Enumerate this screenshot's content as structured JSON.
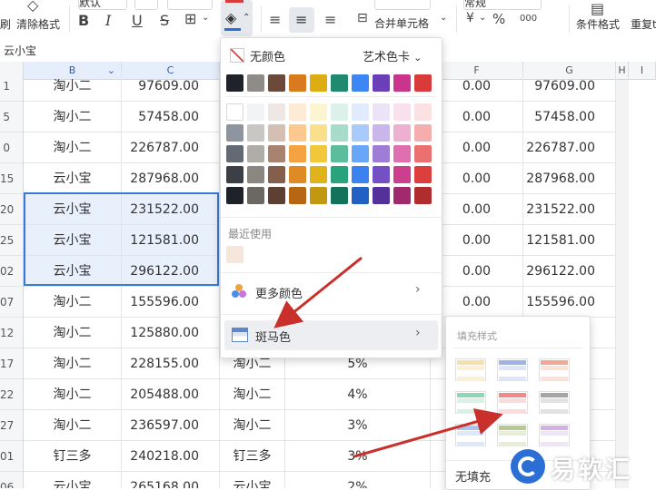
{
  "toolbar": {
    "font_name": "默认",
    "clear_label_partial": "刷",
    "clear_format": "清除格式",
    "merge_cells": "合并单元格",
    "number_format_partial": "常规",
    "conditional_format": "条件格式",
    "redo_partial": "重复t",
    "bold_icon": "B",
    "italic_icon": "I",
    "underline_icon": "U",
    "strike_icon": "S",
    "percent": "%",
    "thousands": "000"
  },
  "namebox": {
    "value": "云小宝"
  },
  "columns": [
    {
      "label": "B"
    },
    {
      "label": "C"
    },
    {
      "label": "F"
    },
    {
      "label": "G"
    },
    {
      "label": "H"
    },
    {
      "label": "I"
    }
  ],
  "rows": [
    {
      "num": "1",
      "b": "淘小二",
      "c": "97609.00",
      "d": "",
      "e": "",
      "f": "0.00",
      "g": "97609.00"
    },
    {
      "num": "5",
      "b": "淘小二",
      "c": "57458.00",
      "d": "",
      "e": "",
      "f": "0.00",
      "g": "57458.00"
    },
    {
      "num": "0",
      "b": "淘小二",
      "c": "226787.00",
      "d": "",
      "e": "",
      "f": "0.00",
      "g": "226787.00"
    },
    {
      "num": "15",
      "b": "云小宝",
      "c": "287968.00",
      "d": "",
      "e": "",
      "f": "0.00",
      "g": "287968.00"
    },
    {
      "num": "20",
      "b": "云小宝",
      "c": "231522.00",
      "d": "",
      "e": "",
      "f": "0.00",
      "g": "231522.00"
    },
    {
      "num": "25",
      "b": "云小宝",
      "c": "121581.00",
      "d": "",
      "e": "",
      "f": "0.00",
      "g": "121581.00"
    },
    {
      "num": "02",
      "b": "云小宝",
      "c": "296122.00",
      "d": "",
      "e": "",
      "f": "0.00",
      "g": "296122.00"
    },
    {
      "num": "07",
      "b": "淘小二",
      "c": "155596.00",
      "d": "",
      "e": "",
      "f": "0.00",
      "g": "155596.00"
    },
    {
      "num": "12",
      "b": "淘小二",
      "c": "125880.00",
      "d": "",
      "e": "",
      "f": "",
      "g": ""
    },
    {
      "num": "17",
      "b": "淘小二",
      "c": "228155.00",
      "d": "淘小二",
      "e": "5%",
      "f": "",
      "g": ""
    },
    {
      "num": "22",
      "b": "淘小二",
      "c": "205488.00",
      "d": "淘小二",
      "e": "4%",
      "f": "",
      "g": ""
    },
    {
      "num": "27",
      "b": "淘小二",
      "c": "236597.00",
      "d": "淘小二",
      "e": "3%",
      "f": "",
      "g": ""
    },
    {
      "num": "01",
      "b": "钉三多",
      "c": "240218.00",
      "d": "钉三多",
      "e": "3%",
      "f": "",
      "g": ""
    },
    {
      "num": "06",
      "b": "云小宝",
      "c": "265168.00",
      "d": "云小宝",
      "e": "2%",
      "f": "",
      "g": ""
    }
  ],
  "color_panel": {
    "no_color": "无颜色",
    "palette_name": "艺术色卡",
    "recent_label": "最近使用",
    "more_colors": "更多颜色",
    "zebra": "斑马色",
    "theme_row": [
      "#1f2329",
      "#8f8b87",
      "#6b4a3a",
      "#d97a1f",
      "#dcae14",
      "#1f8a6e",
      "#3d87f5",
      "#6a3fb8",
      "#c8358a",
      "#d93a3a"
    ],
    "shade_rows": [
      [
        "#ffffff",
        "#f2f3f5",
        "#efe7e3",
        "#fdebd6",
        "#fdf5cf",
        "#dcf1ea",
        "#e0ecfd",
        "#ebe3f6",
        "#f8e0ec",
        "#fbe1e1"
      ],
      [
        "#8f959e",
        "#c9c7c4",
        "#d5bfb3",
        "#fbc98f",
        "#fae08a",
        "#a6dcc9",
        "#a9cbfb",
        "#c9b6ea",
        "#eeb0d0",
        "#f4aeae"
      ],
      [
        "#646a73",
        "#b0aca8",
        "#a88470",
        "#f5a243",
        "#f0c83a",
        "#5cbd9c",
        "#6aa6f8",
        "#9d7dd6",
        "#df6fae",
        "#ec7070"
      ],
      [
        "#3b3f46",
        "#8a8682",
        "#84604c",
        "#e08a25",
        "#e0b21c",
        "#28a37c",
        "#3a82f0",
        "#7450c4",
        "#cc3f8f",
        "#dd3f3f"
      ],
      [
        "#1f2329",
        "#6b6864",
        "#5e4032",
        "#b76614",
        "#c29712",
        "#13735a",
        "#2360c4",
        "#54309a",
        "#a02a6c",
        "#b02d2d"
      ]
    ],
    "recent": [
      "#f6e6dc"
    ]
  },
  "zebra_panel": {
    "title": "填充样式",
    "no_fill": "无填充",
    "styles": [
      {
        "head": "#f6dfa8",
        "band": "#fbf0d4"
      },
      {
        "head": "#9fb3e6",
        "band": "#dde5f8"
      },
      {
        "head": "#f0a992",
        "band": "#fbe1d8"
      },
      {
        "head": "#8fd6b4",
        "band": "#d9f2e6"
      },
      {
        "head": "#f08a8a",
        "band": "#fbdcdc"
      },
      {
        "head": "#a5a5a5",
        "band": "#e2e2e2"
      },
      {
        "head": "#a9c4ee",
        "band": "#dde8f8"
      },
      {
        "head": "#b6c98f",
        "band": "#e6eed6"
      },
      {
        "head": "#d3b0e6",
        "band": "#f0e4f7"
      }
    ]
  },
  "watermark": {
    "text": "易软汇"
  },
  "colors": {
    "accent": "#2b6fd6",
    "arrow": "#c9302c"
  }
}
